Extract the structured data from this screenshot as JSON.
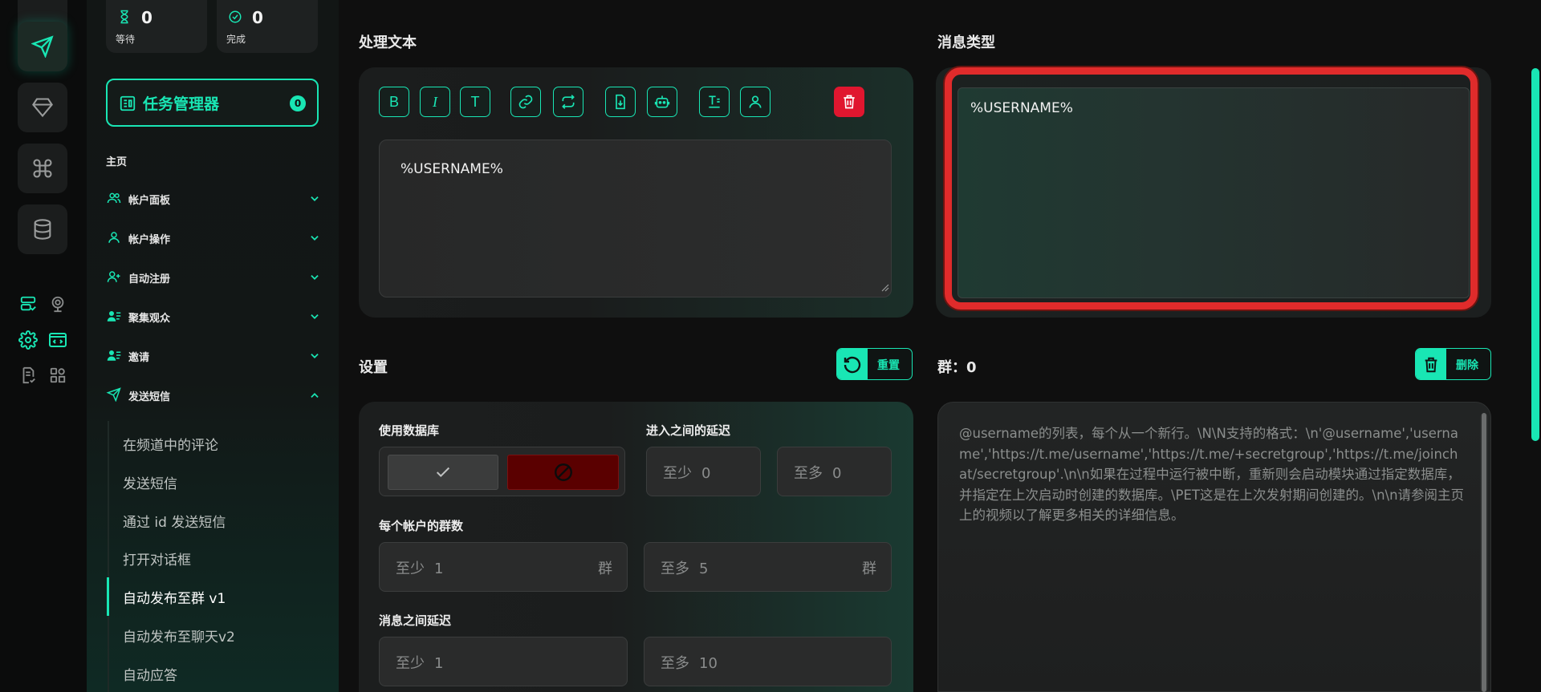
{
  "stats": [
    {
      "value": "0",
      "label": "等待"
    },
    {
      "value": "0",
      "label": "完成"
    }
  ],
  "task_manager": {
    "label": "任务管理器",
    "badge": "0"
  },
  "sidebar": {
    "home": "主页",
    "groups": [
      {
        "label": "帐户面板",
        "expanded": false
      },
      {
        "label": "帐户操作",
        "expanded": false
      },
      {
        "label": "自动注册",
        "expanded": false
      },
      {
        "label": "聚集观众",
        "expanded": false
      },
      {
        "label": "邀请",
        "expanded": false
      },
      {
        "label": "发送短信",
        "expanded": true
      }
    ],
    "subitems": [
      "在频道中的评论",
      "发送短信",
      "通过 id 发送短信",
      "打开对话框",
      "自动发布至群 v1",
      "自动发布至聊天v2",
      "自动应答"
    ],
    "active_subitem": "自动发布至群 v1"
  },
  "edit": {
    "title": "处理文本",
    "text_value": "%USERNAME%"
  },
  "message_type": {
    "title": "消息类型",
    "value": "%USERNAME%"
  },
  "settings": {
    "title": "设置",
    "reset_label": "重置",
    "use_db_label": "使用数据库",
    "delay_join_label": "进入之间的延迟",
    "join_min_ph": "至少",
    "join_min_val": "0",
    "join_max_ph": "至多",
    "join_max_val": "0",
    "groups_per_account_label": "每个帐户的群数",
    "gpa_min_ph": "至少",
    "gpa_min_val": "1",
    "gpa_max_ph": "至多",
    "gpa_max_val": "5",
    "gpa_suffix": "群",
    "msg_delay_label": "消息之间延迟",
    "md_min_ph": "至少",
    "md_min_val": "1",
    "md_max_ph": "至多",
    "md_max_val": "10"
  },
  "groups": {
    "title": "群：0",
    "delete_label": "删除",
    "placeholder": "@username的列表，每个从一个新行。\\N\\N支持的格式：\\n'@username','username','https://t.me/username','https://t.me/+secretgroup','https://t.me/joinchat/secretgroup'.\\n\\n如果在过程中运行被中断，重新则会启动模块通过指定数据库，并指定在上次启动时创建的数据库。\\PET这是在上次发射期间创建的。\\n\\n请参阅主页上的视频以了解更多相关的详细信息。"
  },
  "colors": {
    "accent": "#19e6b4",
    "danger": "#e0162f",
    "highlight": "#e02b2b"
  }
}
